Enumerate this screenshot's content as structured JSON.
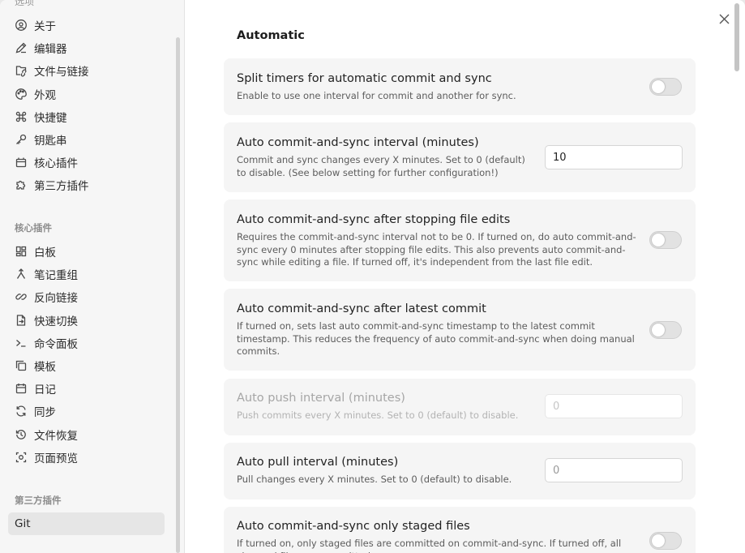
{
  "sidebar": {
    "top_cut_label": "选项",
    "options": [
      {
        "label": "关于",
        "icon": "info-circle-icon"
      },
      {
        "label": "编辑器",
        "icon": "pencil-icon"
      },
      {
        "label": "文件与链接",
        "icon": "folder-link-icon"
      },
      {
        "label": "外观",
        "icon": "palette-icon"
      },
      {
        "label": "快捷键",
        "icon": "command-icon"
      },
      {
        "label": "钥匙串",
        "icon": "key-icon"
      },
      {
        "label": "核心插件",
        "icon": "plugin-icon"
      },
      {
        "label": "第三方插件",
        "icon": "puzzle-icon"
      }
    ],
    "core_title": "核心插件",
    "core_plugins": [
      {
        "label": "白板",
        "icon": "canvas-grid-icon"
      },
      {
        "label": "笔记重组",
        "icon": "merge-icon"
      },
      {
        "label": "反向链接",
        "icon": "backlink-icon"
      },
      {
        "label": "快速切换",
        "icon": "file-switch-icon"
      },
      {
        "label": "命令面板",
        "icon": "terminal-icon"
      },
      {
        "label": "模板",
        "icon": "copy-icon"
      },
      {
        "label": "日记",
        "icon": "calendar-icon"
      },
      {
        "label": "同步",
        "icon": "sync-icon"
      },
      {
        "label": "文件恢复",
        "icon": "history-icon"
      },
      {
        "label": "页面预览",
        "icon": "preview-icon"
      }
    ],
    "third_title": "第三方插件",
    "third_plugins": [
      {
        "label": "Git",
        "active": true
      }
    ]
  },
  "main": {
    "close_icon": "close-icon",
    "section_title": "Automatic",
    "settings": [
      {
        "name": "Split timers for automatic commit and sync",
        "desc": "Enable to use one interval for commit and another for sync.",
        "control": "toggle",
        "enabled": false
      },
      {
        "name": "Auto commit-and-sync interval (minutes)",
        "desc": "Commit and sync changes every X minutes. Set to 0 (default) to disable. (See below setting for further configuration!)",
        "control": "input",
        "value": "10",
        "placeholder": ""
      },
      {
        "name": "Auto commit-and-sync after stopping file edits",
        "desc": "Requires the commit-and-sync interval not to be 0. If turned on, do auto commit-and-sync every 0 minutes after stopping file edits. This also prevents auto commit-and-sync while editing a file. If turned off, it's independent from the last file edit.",
        "control": "toggle",
        "enabled": false
      },
      {
        "name": "Auto commit-and-sync after latest commit",
        "desc": "If turned on, sets last auto commit-and-sync timestamp to the latest commit timestamp. This reduces the frequency of auto commit-and-sync when doing manual commits.",
        "control": "toggle",
        "enabled": false
      },
      {
        "name": "Auto push interval (minutes)",
        "desc": "Push commits every X minutes. Set to 0 (default) to disable.",
        "control": "input",
        "value": "",
        "placeholder": "0",
        "disabled": true
      },
      {
        "name": "Auto pull interval (minutes)",
        "desc": "Pull changes every X minutes. Set to 0 (default) to disable.",
        "control": "input",
        "value": "",
        "placeholder": "0"
      },
      {
        "name": "Auto commit-and-sync only staged files",
        "desc": "If turned on, only staged files are committed on commit-and-sync. If turned off, all changed files are committed.",
        "control": "toggle",
        "enabled": false
      }
    ]
  }
}
